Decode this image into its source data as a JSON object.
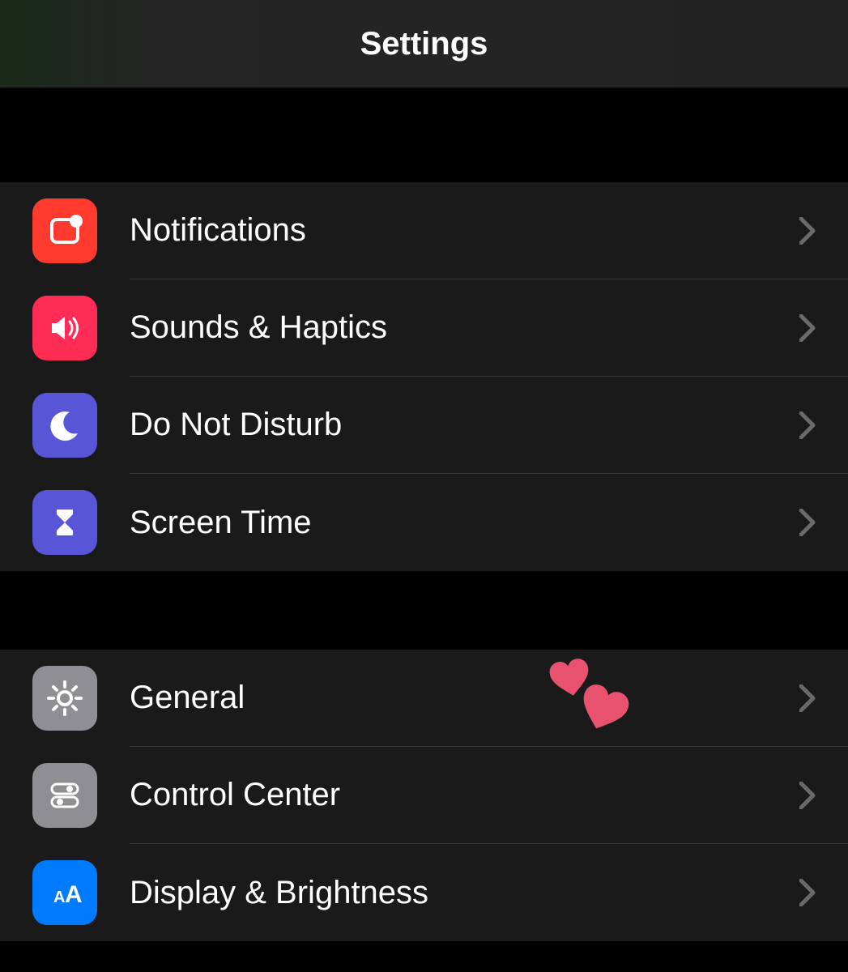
{
  "header": {
    "title": "Settings"
  },
  "sections": [
    {
      "items": [
        {
          "label": "Notifications",
          "icon": "notifications-icon",
          "bg": "#FF3B30"
        },
        {
          "label": "Sounds & Haptics",
          "icon": "speaker-icon",
          "bg": "#FF2D55"
        },
        {
          "label": "Do Not Disturb",
          "icon": "moon-icon",
          "bg": "#5856D6"
        },
        {
          "label": "Screen Time",
          "icon": "hourglass-icon",
          "bg": "#5856D6"
        }
      ]
    },
    {
      "items": [
        {
          "label": "General",
          "icon": "gear-icon",
          "bg": "#8E8E93"
        },
        {
          "label": "Control Center",
          "icon": "toggles-icon",
          "bg": "#8E8E93"
        },
        {
          "label": "Display & Brightness",
          "icon": "text-size-icon",
          "bg": "#007AFF"
        }
      ]
    }
  ]
}
